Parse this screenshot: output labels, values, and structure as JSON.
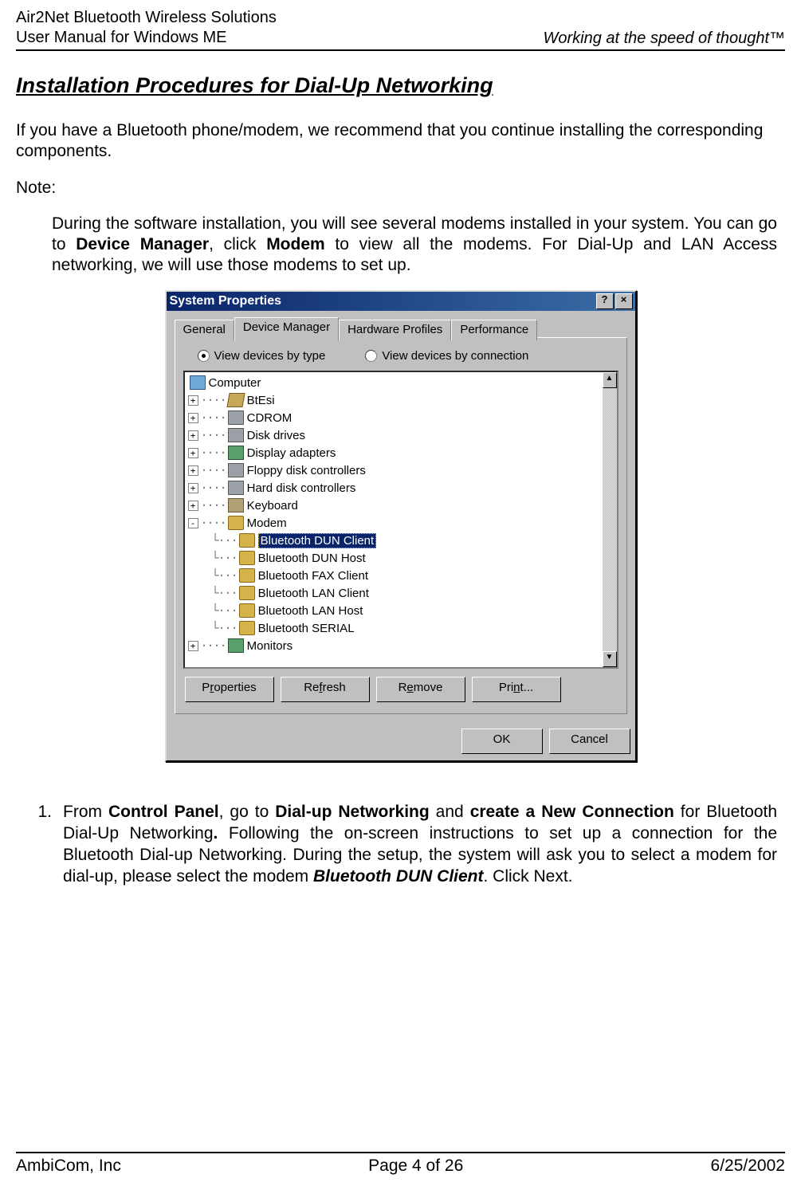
{
  "header": {
    "left_line1": "Air2Net Bluetooth Wireless Solutions",
    "left_line2": "User Manual for Windows ME",
    "right": "Working at the speed of thought™"
  },
  "section_title": "Installation Procedures for Dial-Up Networking",
  "intro": "If you have a Bluetooth phone/modem, we recommend that you continue installing the corresponding components.",
  "note_label": "Note:",
  "note_body_pre": "During the software installation, you will see several modems installed in your system.  You can go to ",
  "note_body_b1": "Device Manager",
  "note_body_mid1": ", click ",
  "note_body_b2": "Modem",
  "note_body_post": " to view all the modems. For Dial-Up and LAN Access networking, we will use those modems to set up.",
  "dialog": {
    "title": "System Properties",
    "tabs": {
      "general": "General",
      "devmgr": "Device Manager",
      "hw": "Hardware Profiles",
      "perf": "Performance"
    },
    "radio": {
      "bytype": "View devices by type",
      "byconn": "View devices by connection"
    },
    "tree": {
      "root": "Computer",
      "items": [
        "BtEsi",
        "CDROM",
        "Disk drives",
        "Display adapters",
        "Floppy disk controllers",
        "Hard disk controllers",
        "Keyboard",
        "Modem"
      ],
      "modem_children": [
        "Bluetooth DUN Client",
        "Bluetooth DUN Host",
        "Bluetooth FAX Client",
        "Bluetooth LAN Client",
        "Bluetooth LAN Host",
        "Bluetooth SERIAL"
      ],
      "tail": "Monitors"
    },
    "buttons": {
      "properties": "Properties",
      "refresh": "Refresh",
      "remove": "Remove",
      "print": "Print..."
    },
    "ok": "OK",
    "cancel": "Cancel"
  },
  "step": {
    "num": "1.",
    "text_pre": "From ",
    "b1": "Control Panel",
    "t1": ", go to ",
    "b2": "Dial-up Networking",
    "t2": " and ",
    "b3": "create a New Connection",
    "t3": " for Bluetooth Dial-Up Networking",
    "b4": ".",
    "t4": "   Following the on-screen instructions to set up a connection for the Bluetooth Dial-up Networking. During the setup, the system will ask you to select a modem for dial-up, please select the modem ",
    "bi": "Bluetooth DUN Client",
    "t5": ".   Click Next."
  },
  "footer": {
    "left": "AmbiCom, Inc",
    "center": "Page 4 of 26",
    "right": "6/25/2002"
  }
}
